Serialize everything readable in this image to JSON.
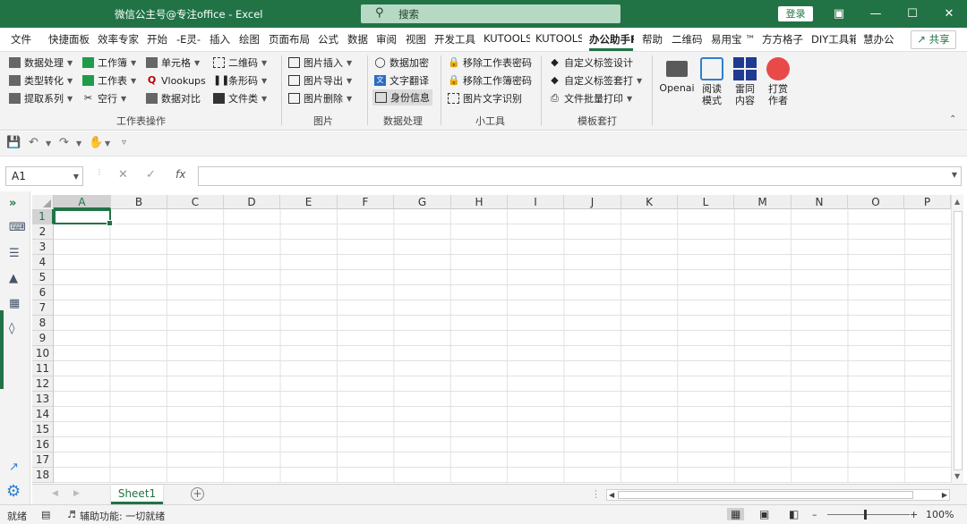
{
  "titlebar": {
    "title": "微信公主号@专注office  -  Excel",
    "search_placeholder": "搜索",
    "login_label": "登录",
    "bg_color": "#217346"
  },
  "tabs": [
    "文件",
    "快捷面板",
    "效率专家",
    "开始",
    "-E灵-",
    "插入",
    "绘图",
    "页面布局",
    "公式",
    "数据",
    "审阅",
    "视图",
    "开发工具",
    "KUTOOLS",
    "KUTOOLS",
    "办公助手F",
    "帮助",
    "二维码",
    "易用宝 ™",
    "方方格子",
    "DIY工具箱",
    "慧办公"
  ],
  "active_tab": "办公助手F",
  "share_label": "共享",
  "ribbon": {
    "worksheet_ops": {
      "items": [
        "数据处理",
        "工作簿",
        "单元格",
        "二维码",
        "类型转化",
        "工作表",
        "Vlookups",
        "条形码",
        "提取系列",
        "空行",
        "数据对比",
        "文件类"
      ],
      "group_label": "工作表操作"
    },
    "image": {
      "items": [
        "图片插入",
        "图片导出",
        "图片删除"
      ],
      "group_label": "图片"
    },
    "data_proc": {
      "items": [
        "数据加密",
        "文字翻译",
        "身份信息"
      ],
      "group_label": "数据处理"
    },
    "tools": {
      "items": [
        "移除工作表密码",
        "移除工作簿密码",
        "图片文字识别"
      ],
      "group_label": "小工具"
    },
    "template": {
      "items": [
        "自定义标签设计",
        "自定义标签套打",
        "文件批量打印"
      ],
      "group_label": "模板套打"
    },
    "big_buttons": [
      {
        "line1": "Openai",
        "line2": ""
      },
      {
        "line1": "阅读",
        "line2": "模式"
      },
      {
        "line1": "雷同",
        "line2": "内容"
      },
      {
        "line1": "打赏",
        "line2": "作者"
      }
    ]
  },
  "formula_bar": {
    "name_box": "A1",
    "fx": "fx",
    "cancel": "✕",
    "confirm": "✓",
    "formula": ""
  },
  "columns": [
    "A",
    "B",
    "C",
    "D",
    "E",
    "F",
    "G",
    "H",
    "I",
    "J",
    "K",
    "L",
    "M",
    "N",
    "O",
    "P"
  ],
  "rows": [
    "1",
    "2",
    "3",
    "4",
    "5",
    "6",
    "7",
    "8",
    "9",
    "10",
    "11",
    "12",
    "13",
    "14",
    "15",
    "16",
    "17",
    "18"
  ],
  "selected_cell": "A1",
  "sheets": [
    "Sheet1"
  ],
  "status": {
    "ready": "就绪",
    "accessibility": "辅助功能: 一切就绪",
    "zoom": "100%"
  }
}
